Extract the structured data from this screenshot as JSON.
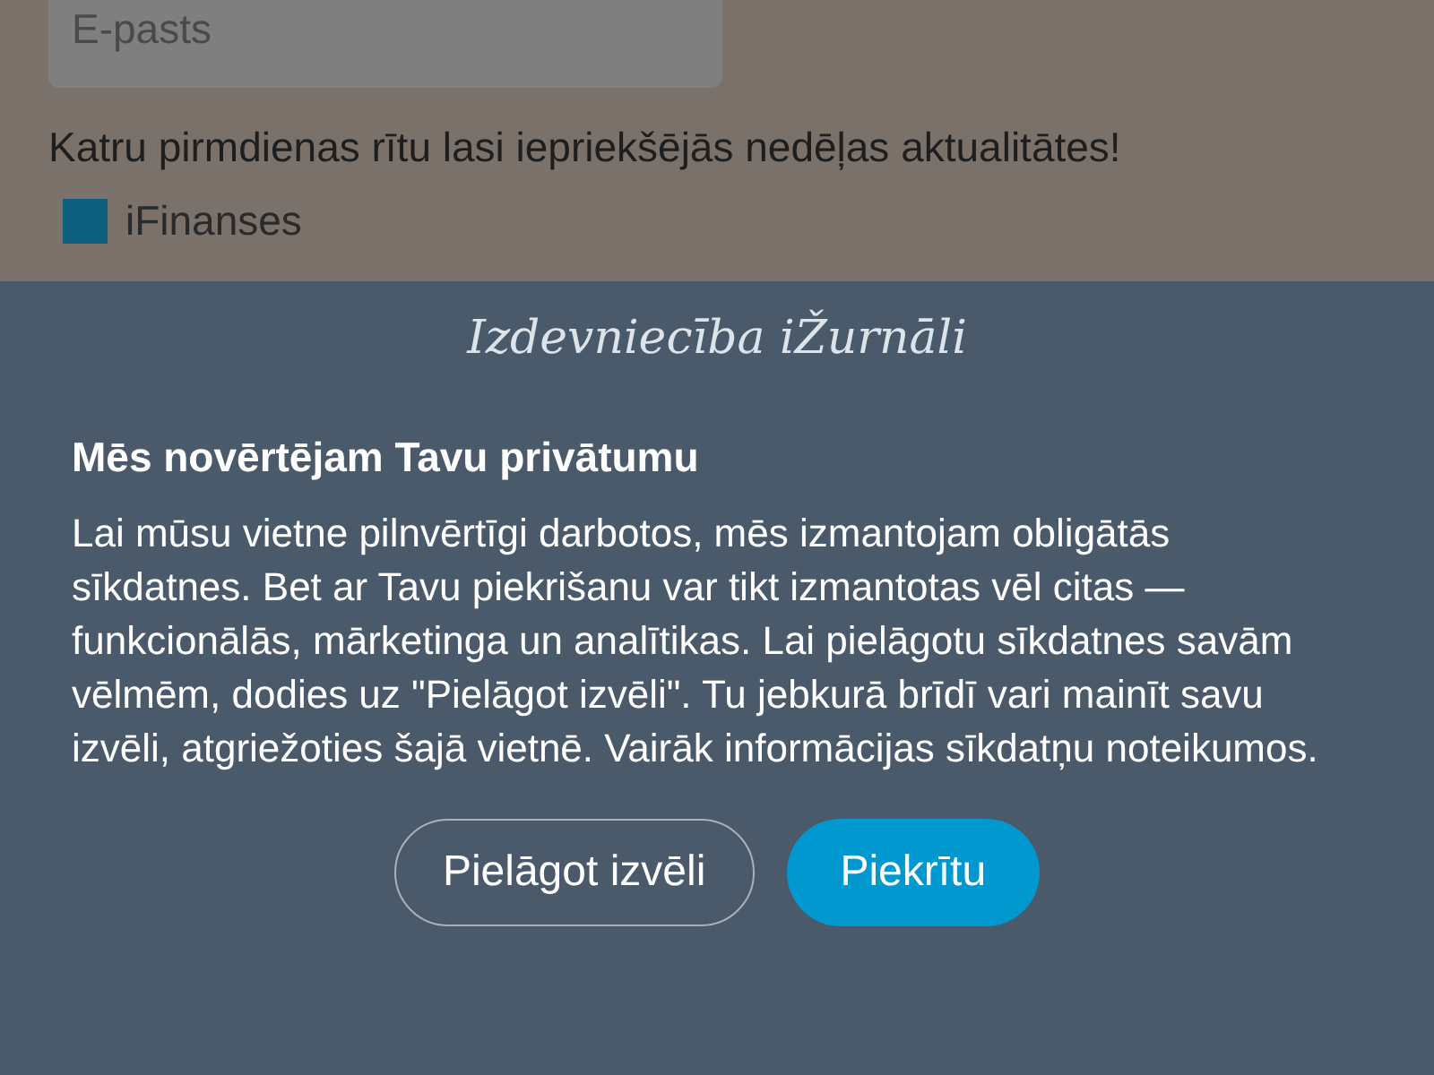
{
  "signup": {
    "email_field": {
      "placeholder": "E-pasts"
    },
    "tagline": "Katru pirmdienas rītu lasi iepriekšējās nedēļas aktualitātes!",
    "options": [
      {
        "label": "iFinanses",
        "checked": true
      }
    ]
  },
  "cookie_banner": {
    "logo": "Izdevniecība iŽurnāli",
    "title": "Mēs novērtējam Tavu privātumu",
    "text": "Lai mūsu vietne pilnvērtīgi darbotos, mēs izmantojam obligātās sīkdatnes. Bet ar Tavu piekrišanu var tikt izmantotas vēl citas — funkcionālās, mārketinga un analītikas. Lai pielāgotu sīkdatnes savām vēlmēm, dodies uz \"Pielāgot izvēli\". Tu jebkurā brīdī vari mainīt savu izvēli, atgriežoties šajā vietnē. Vairāk informācijas sīkdatņu noteikumos.",
    "buttons": [
      {
        "label": "Pielāgot izvēli",
        "kind": "outline"
      },
      {
        "label": "Piekrītu",
        "kind": "primary"
      }
    ]
  }
}
